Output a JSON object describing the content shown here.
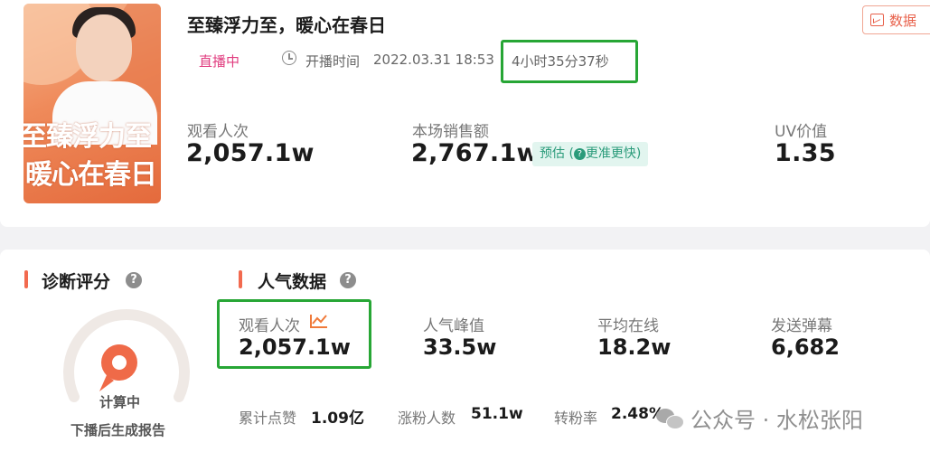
{
  "header": {
    "title": "至臻浮力至，暖心在春日",
    "data_button_label": "数据",
    "live_status": "直播中",
    "start_time_label": "开播时间",
    "start_time_value": "2022.03.31 18:53",
    "duration": "4小时35分37秒"
  },
  "cover": {
    "line1": "至臻浮力至",
    "line2": "暖心在春日"
  },
  "overview": {
    "metrics": [
      {
        "label": "观看人次",
        "value": "2,057.1w"
      },
      {
        "label": "本场销售额",
        "value": "2,767.1w"
      },
      {
        "label": "UV价值",
        "value": "1.35"
      }
    ],
    "estimate_tag": "预估",
    "estimate_hint": "更准更快"
  },
  "diagnosis": {
    "title": "诊断评分",
    "status": "计算中",
    "note": "下播后生成报告"
  },
  "popularity": {
    "title": "人气数据",
    "metrics": [
      {
        "label": "观看人次",
        "value": "2,057.1w"
      },
      {
        "label": "人气峰值",
        "value": "33.5w"
      },
      {
        "label": "平均在线",
        "value": "18.2w"
      },
      {
        "label": "发送弹幕",
        "value": "6,682"
      }
    ],
    "secondary": [
      {
        "label": "累计点赞",
        "value": "1.09亿"
      },
      {
        "label": "涨粉人数",
        "value": "51.1w"
      },
      {
        "label": "转粉率",
        "value": "2.48%"
      }
    ]
  },
  "watermark": {
    "text": "公众号 · 水松张阳"
  },
  "colors": {
    "accent": "#f26a4f",
    "highlight_box": "#27a635",
    "live": "#e03c7f",
    "estimate_bg": "#e2f5ef"
  }
}
